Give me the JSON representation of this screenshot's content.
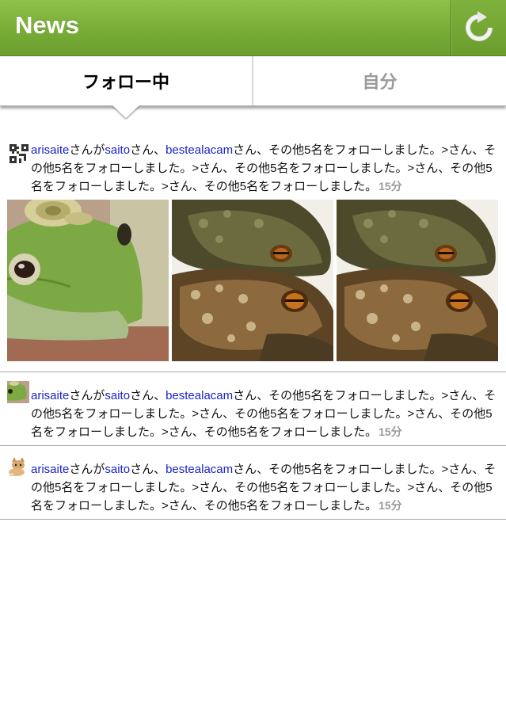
{
  "header": {
    "title": "News",
    "refresh_icon": "refresh-icon"
  },
  "tabs": [
    {
      "label": "フォロー中",
      "active": true
    },
    {
      "label": "自分",
      "active": false
    }
  ],
  "feed": [
    {
      "avatar": "qr-code-avatar",
      "user": "arisaite",
      "mid1": "さんが",
      "target1": "saito",
      "mid2": "さん、",
      "target2": "bestealacam",
      "rest": "さん、その他5名をフォローしました。>さん、その他5名をフォローしました。>さん、その他5名をフォローしました。>さん、その他5名をフォローしました。>さん、その他5名をフォローしました。",
      "time": "15分",
      "thumbnails": [
        "green-frog-with-snail",
        "toad-pair",
        "toad-pair"
      ]
    },
    {
      "avatar": "frog-avatar",
      "user": "arisaite",
      "mid1": "さんが",
      "target1": "saito",
      "mid2": "さん、",
      "target2": "bestealacam",
      "rest": "さん、その他5名をフォローしました。>さん、その他5名をフォローしました。>さん、その他5名をフォローしました。>さん、その他5名をフォローしました。>さん、その他5名をフォローしました。",
      "time": "15分"
    },
    {
      "avatar": "kitten-avatar",
      "user": "arisaite",
      "mid1": "さんが",
      "target1": "saito",
      "mid2": "さん、",
      "target2": "bestealacam",
      "rest": "さん、その他5名をフォローしました。>さん、その他5名をフォローしました。>さん、その他5名をフォローしました。>さん、その他5名をフォローしました。>さん、その他5名をフォローしました。",
      "time": "15分"
    }
  ],
  "colors": {
    "nav_green": "#77ac36",
    "link": "#1a24c8",
    "time_gray": "#9a9a9a"
  }
}
